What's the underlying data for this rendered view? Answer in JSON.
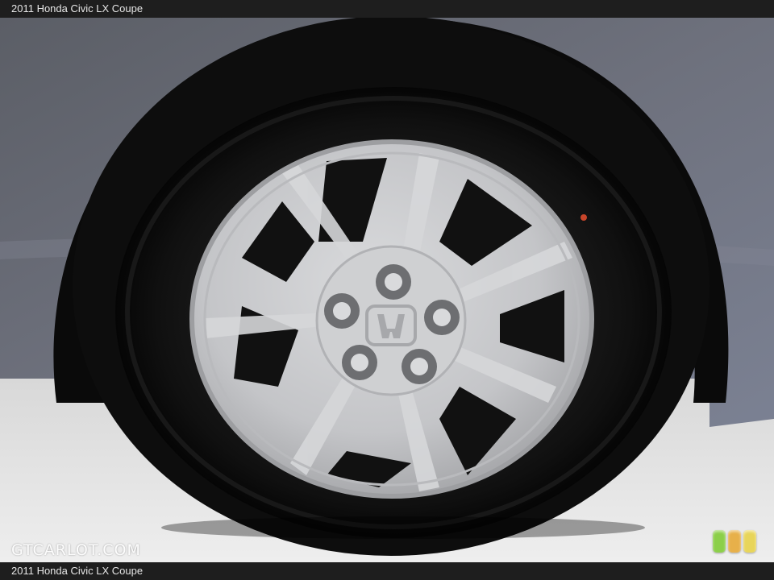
{
  "title_top": "2011 Honda Civic LX Coupe",
  "title_bottom": "2011 Honda Civic LX Coupe",
  "watermark": "GTCARLOT.COM",
  "colors": {
    "car_body": "#6f7280",
    "tire": "#141414",
    "wheel_cover": "#c9cacc",
    "floor": "#e4e4e4",
    "bar": "#1e1e1e",
    "badge": [
      "#8ccf4a",
      "#e7b04a",
      "#e8d55a"
    ]
  },
  "photo_subject": "wheel-icon"
}
